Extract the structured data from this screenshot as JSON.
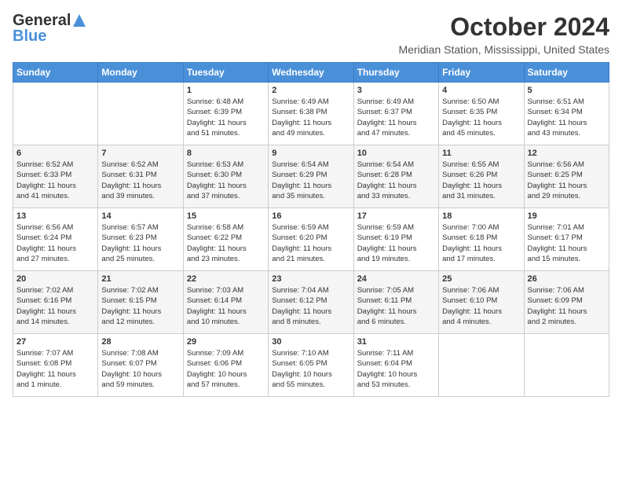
{
  "logo": {
    "general": "General",
    "blue": "Blue"
  },
  "title": "October 2024",
  "subtitle": "Meridian Station, Mississippi, United States",
  "days_header": [
    "Sunday",
    "Monday",
    "Tuesday",
    "Wednesday",
    "Thursday",
    "Friday",
    "Saturday"
  ],
  "weeks": [
    [
      {
        "num": "",
        "info": ""
      },
      {
        "num": "",
        "info": ""
      },
      {
        "num": "1",
        "info": "Sunrise: 6:48 AM\nSunset: 6:39 PM\nDaylight: 11 hours\nand 51 minutes."
      },
      {
        "num": "2",
        "info": "Sunrise: 6:49 AM\nSunset: 6:38 PM\nDaylight: 11 hours\nand 49 minutes."
      },
      {
        "num": "3",
        "info": "Sunrise: 6:49 AM\nSunset: 6:37 PM\nDaylight: 11 hours\nand 47 minutes."
      },
      {
        "num": "4",
        "info": "Sunrise: 6:50 AM\nSunset: 6:35 PM\nDaylight: 11 hours\nand 45 minutes."
      },
      {
        "num": "5",
        "info": "Sunrise: 6:51 AM\nSunset: 6:34 PM\nDaylight: 11 hours\nand 43 minutes."
      }
    ],
    [
      {
        "num": "6",
        "info": "Sunrise: 6:52 AM\nSunset: 6:33 PM\nDaylight: 11 hours\nand 41 minutes."
      },
      {
        "num": "7",
        "info": "Sunrise: 6:52 AM\nSunset: 6:31 PM\nDaylight: 11 hours\nand 39 minutes."
      },
      {
        "num": "8",
        "info": "Sunrise: 6:53 AM\nSunset: 6:30 PM\nDaylight: 11 hours\nand 37 minutes."
      },
      {
        "num": "9",
        "info": "Sunrise: 6:54 AM\nSunset: 6:29 PM\nDaylight: 11 hours\nand 35 minutes."
      },
      {
        "num": "10",
        "info": "Sunrise: 6:54 AM\nSunset: 6:28 PM\nDaylight: 11 hours\nand 33 minutes."
      },
      {
        "num": "11",
        "info": "Sunrise: 6:55 AM\nSunset: 6:26 PM\nDaylight: 11 hours\nand 31 minutes."
      },
      {
        "num": "12",
        "info": "Sunrise: 6:56 AM\nSunset: 6:25 PM\nDaylight: 11 hours\nand 29 minutes."
      }
    ],
    [
      {
        "num": "13",
        "info": "Sunrise: 6:56 AM\nSunset: 6:24 PM\nDaylight: 11 hours\nand 27 minutes."
      },
      {
        "num": "14",
        "info": "Sunrise: 6:57 AM\nSunset: 6:23 PM\nDaylight: 11 hours\nand 25 minutes."
      },
      {
        "num": "15",
        "info": "Sunrise: 6:58 AM\nSunset: 6:22 PM\nDaylight: 11 hours\nand 23 minutes."
      },
      {
        "num": "16",
        "info": "Sunrise: 6:59 AM\nSunset: 6:20 PM\nDaylight: 11 hours\nand 21 minutes."
      },
      {
        "num": "17",
        "info": "Sunrise: 6:59 AM\nSunset: 6:19 PM\nDaylight: 11 hours\nand 19 minutes."
      },
      {
        "num": "18",
        "info": "Sunrise: 7:00 AM\nSunset: 6:18 PM\nDaylight: 11 hours\nand 17 minutes."
      },
      {
        "num": "19",
        "info": "Sunrise: 7:01 AM\nSunset: 6:17 PM\nDaylight: 11 hours\nand 15 minutes."
      }
    ],
    [
      {
        "num": "20",
        "info": "Sunrise: 7:02 AM\nSunset: 6:16 PM\nDaylight: 11 hours\nand 14 minutes."
      },
      {
        "num": "21",
        "info": "Sunrise: 7:02 AM\nSunset: 6:15 PM\nDaylight: 11 hours\nand 12 minutes."
      },
      {
        "num": "22",
        "info": "Sunrise: 7:03 AM\nSunset: 6:14 PM\nDaylight: 11 hours\nand 10 minutes."
      },
      {
        "num": "23",
        "info": "Sunrise: 7:04 AM\nSunset: 6:12 PM\nDaylight: 11 hours\nand 8 minutes."
      },
      {
        "num": "24",
        "info": "Sunrise: 7:05 AM\nSunset: 6:11 PM\nDaylight: 11 hours\nand 6 minutes."
      },
      {
        "num": "25",
        "info": "Sunrise: 7:06 AM\nSunset: 6:10 PM\nDaylight: 11 hours\nand 4 minutes."
      },
      {
        "num": "26",
        "info": "Sunrise: 7:06 AM\nSunset: 6:09 PM\nDaylight: 11 hours\nand 2 minutes."
      }
    ],
    [
      {
        "num": "27",
        "info": "Sunrise: 7:07 AM\nSunset: 6:08 PM\nDaylight: 11 hours\nand 1 minute."
      },
      {
        "num": "28",
        "info": "Sunrise: 7:08 AM\nSunset: 6:07 PM\nDaylight: 10 hours\nand 59 minutes."
      },
      {
        "num": "29",
        "info": "Sunrise: 7:09 AM\nSunset: 6:06 PM\nDaylight: 10 hours\nand 57 minutes."
      },
      {
        "num": "30",
        "info": "Sunrise: 7:10 AM\nSunset: 6:05 PM\nDaylight: 10 hours\nand 55 minutes."
      },
      {
        "num": "31",
        "info": "Sunrise: 7:11 AM\nSunset: 6:04 PM\nDaylight: 10 hours\nand 53 minutes."
      },
      {
        "num": "",
        "info": ""
      },
      {
        "num": "",
        "info": ""
      }
    ]
  ]
}
